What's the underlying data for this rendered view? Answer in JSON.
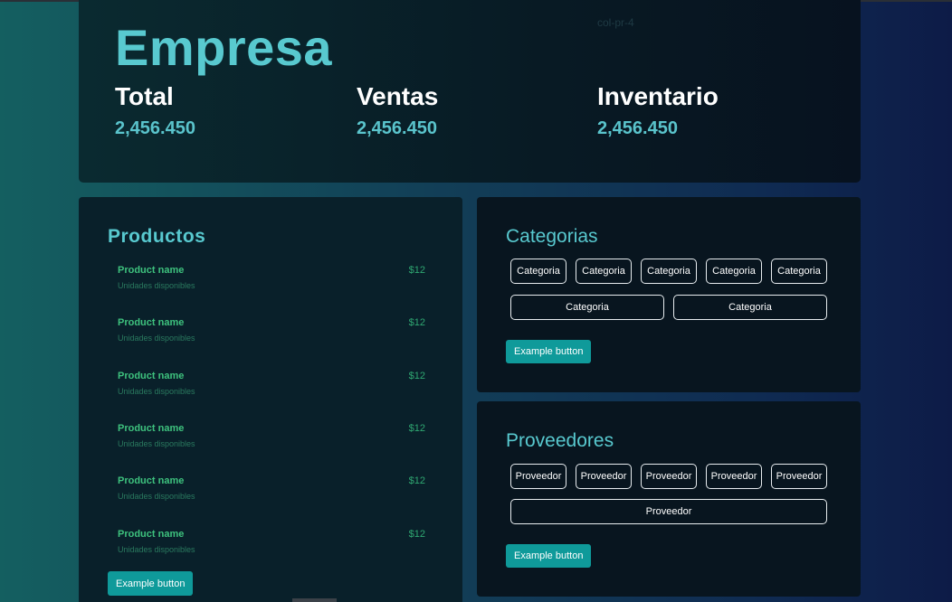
{
  "header": {
    "brand": "Empresa",
    "ghost_text": "col-pr-4",
    "stats": [
      {
        "label": "Total",
        "value": "2,456.450"
      },
      {
        "label": "Ventas",
        "value": "2,456.450"
      },
      {
        "label": "Inventario",
        "value": "2,456.450"
      }
    ]
  },
  "productos": {
    "title": "Productos",
    "items": [
      {
        "name": "Product name",
        "units": "Unidades disponibles",
        "price": "$12"
      },
      {
        "name": "Product name",
        "units": "Unidades disponibles",
        "price": "$12"
      },
      {
        "name": "Product name",
        "units": "Unidades disponibles",
        "price": "$12"
      },
      {
        "name": "Product name",
        "units": "Unidades disponibles",
        "price": "$12"
      },
      {
        "name": "Product name",
        "units": "Unidades disponibles",
        "price": "$12"
      },
      {
        "name": "Product name",
        "units": "Unidades disponibles",
        "price": "$12"
      }
    ],
    "button_label": "Example button"
  },
  "categorias": {
    "title": "Categorias",
    "chips": [
      "Categoria",
      "Categoria",
      "Categoria",
      "Categoria",
      "Categoria",
      "Categoria",
      "Categoria"
    ],
    "button_label": "Example button"
  },
  "proveedores": {
    "title": "Proveedores",
    "chips": [
      "Proveedor",
      "Proveedor",
      "Proveedor",
      "Proveedor",
      "Proveedor",
      "Proveedor"
    ],
    "button_label": "Example button"
  },
  "colors": {
    "accent": "#58c9cf",
    "button": "#0f9a9a",
    "product_name": "#3ec27e"
  }
}
